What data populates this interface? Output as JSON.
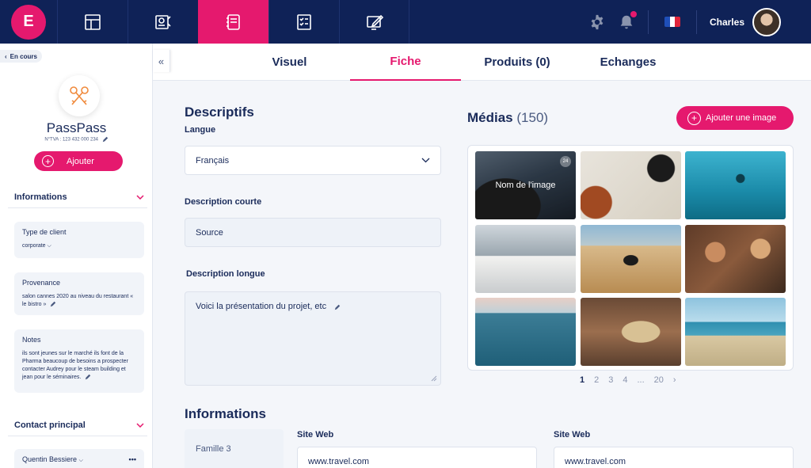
{
  "colors": {
    "accent": "#e5196e",
    "navy": "#0f2257"
  },
  "app": {
    "logo_letter": "E"
  },
  "topnav": {
    "tabs": [
      {
        "icon": "layout-icon"
      },
      {
        "icon": "presentation-icon"
      },
      {
        "icon": "notebook-icon",
        "active": true
      },
      {
        "icon": "checklist-icon"
      },
      {
        "icon": "design-icon"
      }
    ],
    "user_name": "Charles",
    "notification_badge": true,
    "language_flag": "fr"
  },
  "sidebar": {
    "back_label": "En cours",
    "company_name": "PassPass",
    "tva": "N°TVA : 123 432 000 234",
    "add_label": "Ajouter",
    "informations_header": "Informations",
    "client_type_label": "Type de client",
    "client_type_value": "corporate",
    "provenance_label": "Provenance",
    "provenance_value": "salon cannes 2020 au niveau du restaurant « le bistro »",
    "notes_label": "Notes",
    "notes_value": "ils sont jeunes sur le marché ils font de la Pharma beaucoup de besoins a prospecter contacter Audrey pour le steam building et jean pour le séminaires.",
    "contact_header": "Contact principal",
    "contact_name": "Quentin Bessiere"
  },
  "subtabs": [
    {
      "label": "Visuel"
    },
    {
      "label": "Fiche",
      "active": true
    },
    {
      "label": "Produits (0)"
    },
    {
      "label": "Echanges"
    }
  ],
  "descriptifs": {
    "title": "Descriptifs",
    "langue_label": "Langue",
    "langue_value": "Français",
    "short_label": "Description courte",
    "short_value": "Source",
    "long_label": "Description longue",
    "long_value": "Voici la présentation du projet, etc"
  },
  "medias": {
    "title": "Médias",
    "count": "(150)",
    "add_label": "Ajouter une image",
    "first_image_label": "Nom de l'image",
    "first_image_count": "24",
    "pagination": [
      "1",
      "2",
      "3",
      "4",
      "...",
      "20"
    ],
    "current_page": "1"
  },
  "informations": {
    "title": "Informations",
    "famille": "Famille 3",
    "site_web_label_1": "Site Web",
    "site_web_value_1": "www.travel.com",
    "site_web_label_2": "Site Web",
    "site_web_value_2": "www.travel.com"
  }
}
